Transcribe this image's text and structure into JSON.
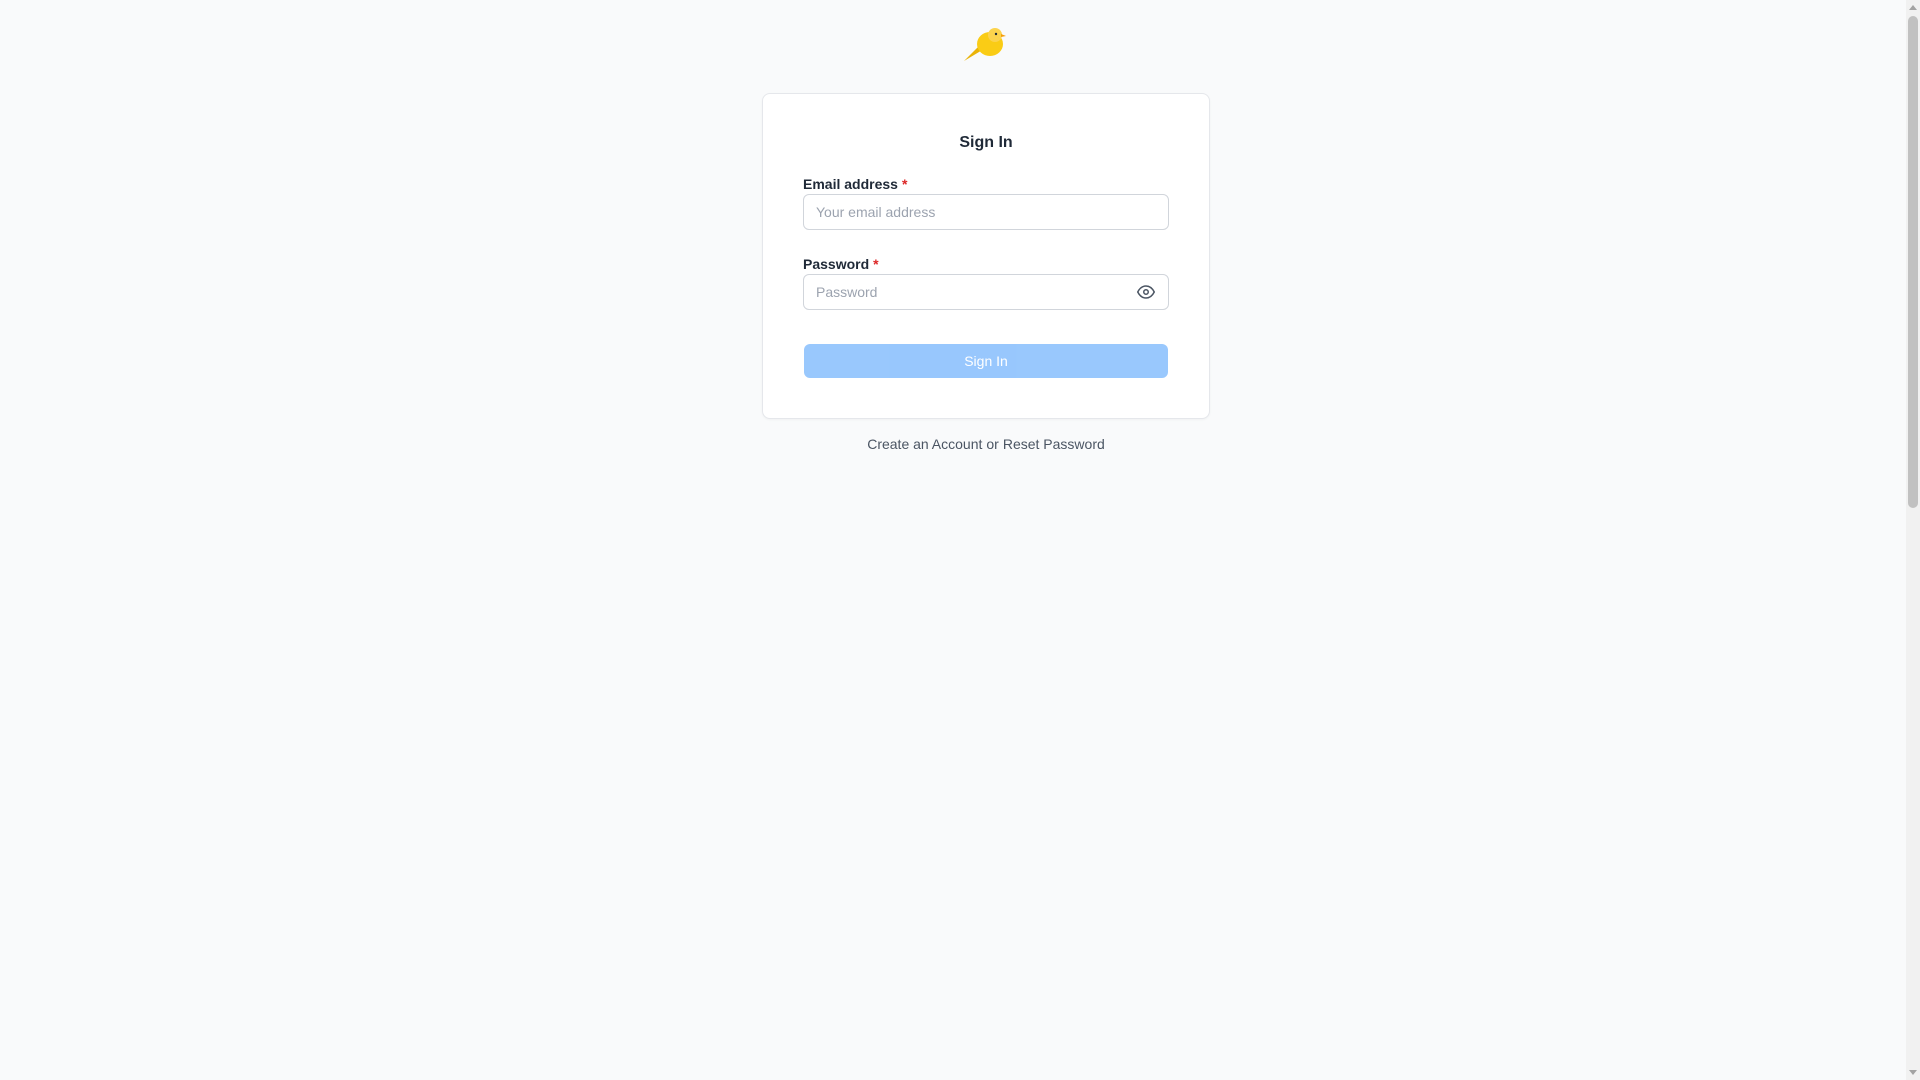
{
  "app": {
    "logo_icon": "canary-bird-icon",
    "logo_color": "#facc15"
  },
  "signin": {
    "title": "Sign In",
    "email": {
      "label": "Email address",
      "required_mark": "*",
      "placeholder": "Your email address",
      "value": ""
    },
    "password": {
      "label": "Password",
      "required_mark": "*",
      "placeholder": "Password",
      "value": "",
      "toggle_icon": "eye-icon"
    },
    "submit_label": "Sign In",
    "submit_color": "#93c5fd"
  },
  "footer": {
    "create_account": "Create an Account",
    "separator": "or",
    "reset_password": "Reset Password"
  }
}
